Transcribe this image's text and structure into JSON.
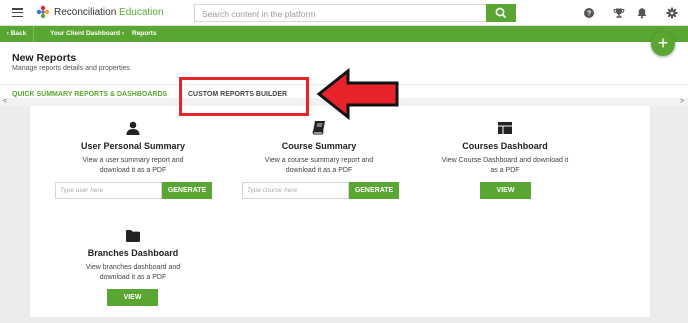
{
  "topbar": {
    "logo_text_1": "Reconciliation",
    "logo_text_2": "Education",
    "search_placeholder": "Search content in the platform",
    "icons": [
      "menu-icon",
      "search-icon",
      "help-icon",
      "trophy-icon",
      "bell-icon",
      "gear-icon"
    ]
  },
  "breadcrumb": {
    "back_label": "Back",
    "items": [
      "Your Client Dashboard",
      "Reports"
    ],
    "separator": "›"
  },
  "fab": {
    "label": "+"
  },
  "header": {
    "title": "New Reports",
    "subtitle": "Manage reports details and properties"
  },
  "tabs": [
    {
      "label": "QUICK SUMMARY REPORTS & DASHBOARDS",
      "active": true
    },
    {
      "label": "CUSTOM REPORTS BUILDER",
      "active": false
    }
  ],
  "scroll": {
    "left": "<",
    "right": ">"
  },
  "cards": [
    {
      "icon": "user-icon",
      "title": "User Personal Summary",
      "desc_1": "View a user summary report and",
      "desc_2": "download it as a PDF",
      "input_placeholder": "Type user here",
      "button": "GENERATE"
    },
    {
      "icon": "book-icon",
      "title": "Course Summary",
      "desc_1": "View a course summary report and",
      "desc_2": "download it as a PDF",
      "input_placeholder": "Type course here",
      "button": "GENERATE"
    },
    {
      "icon": "dashboard-icon",
      "title": "Courses Dashboard",
      "desc_1": "View Course Dashboard and download it",
      "desc_2": "as a PDF",
      "button": "VIEW"
    },
    {
      "icon": "folder-icon",
      "title": "Branches Dashboard",
      "desc_1": "View branches dashboard and",
      "desc_2": "download it as a PDF",
      "button": "VIEW"
    }
  ],
  "colors": {
    "brand_green": "#5aa632",
    "annotation_red": "#e8232a"
  }
}
